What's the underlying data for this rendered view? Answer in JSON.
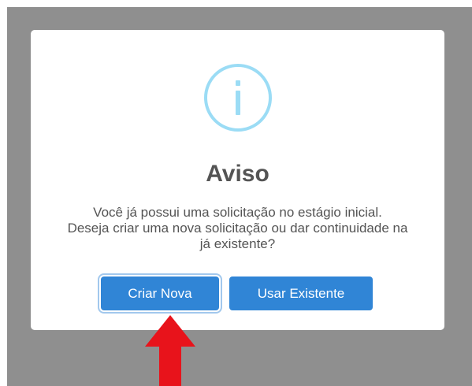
{
  "dialog": {
    "icon": "info-icon",
    "title": "Aviso",
    "message_lines": [
      "Você já possui uma solicitação no estágio inicial.",
      "Deseja criar uma nova solicitação ou dar continuidade na",
      "já existente?"
    ],
    "buttons": {
      "create_new": "Criar Nova",
      "use_existing": "Usar Existente"
    }
  },
  "annotation": {
    "icon": "red-arrow-up-icon",
    "color": "#e8131b"
  },
  "colors": {
    "overlay": "#8f8f8f",
    "icon_ring": "#9bdcf5",
    "button": "#3085d6",
    "text": "#545454"
  }
}
